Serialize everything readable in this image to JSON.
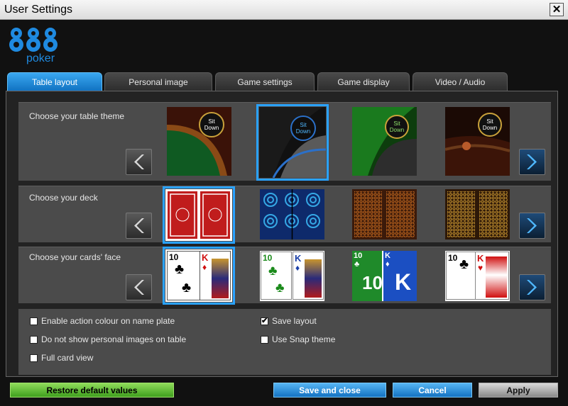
{
  "window": {
    "title": "User Settings",
    "close_symbol": "✕"
  },
  "logo": {
    "numerals": "888",
    "word": "poker"
  },
  "tabs": [
    {
      "label": "Table layout",
      "active": true
    },
    {
      "label": "Personal image",
      "active": false
    },
    {
      "label": "Game settings",
      "active": false
    },
    {
      "label": "Game display",
      "active": false
    },
    {
      "label": "Video / Audio",
      "active": false
    }
  ],
  "theme": {
    "label": "Choose your table theme",
    "seat_button": "Sit Down",
    "seat_line1": "Sit",
    "seat_line2": "Down",
    "selected_index": 1,
    "options": [
      {
        "felt": "#0f5a22",
        "rail": "#8a4a16",
        "bg": "#3a1208"
      },
      {
        "felt": "#1c1c1c",
        "rail": "#2b70c9",
        "bg": "#777777"
      },
      {
        "felt": "#1a7a1e",
        "rail": "#0d3d0d",
        "bg": "#2d2d2d"
      },
      {
        "felt": "#3b1408",
        "rail": "#6b3a1a",
        "bg": "#1b0a05"
      }
    ]
  },
  "deck": {
    "label": "Choose your deck",
    "selected_index": 0,
    "options": [
      {
        "back": "#c01c1c",
        "pattern": "#ffffff"
      },
      {
        "back": "#0e2a6b",
        "pattern": "#35a8e6"
      },
      {
        "back": "#3b1a0a",
        "pattern": "#e27a23"
      },
      {
        "back": "#2d1808",
        "pattern": "#f0b53a"
      }
    ]
  },
  "faces": {
    "label": "Choose your cards' face",
    "selected_index": 0,
    "options": [
      {
        "left_rank": "10",
        "left_suit": "♣",
        "right_rank": "K",
        "right_suit": "♦",
        "style": "classic"
      },
      {
        "left_rank": "10",
        "left_suit": "♣",
        "right_rank": "K",
        "right_suit": "♦",
        "style": "color"
      },
      {
        "left_rank": "10",
        "left_suit": "♣",
        "right_rank": "K",
        "right_suit": "♦",
        "style": "four-color"
      },
      {
        "left_rank": "10",
        "left_suit": "♣",
        "right_rank": "K",
        "right_suit": "♥",
        "style": "large"
      }
    ]
  },
  "options": {
    "enable_action_colour": {
      "label": "Enable action colour on name plate",
      "checked": false
    },
    "no_personal_images": {
      "label": "Do not show personal images on table",
      "checked": false
    },
    "full_card_view": {
      "label": "Full card view",
      "checked": false
    },
    "save_layout": {
      "label": "Save layout",
      "checked": true
    },
    "use_snap_theme": {
      "label": "Use Snap theme",
      "checked": false
    }
  },
  "buttons": {
    "restore": "Restore default values",
    "save_close": "Save and close",
    "cancel": "Cancel",
    "apply": "Apply"
  },
  "icons": {
    "left_arrow": "chevron-left-icon",
    "right_arrow": "chevron-right-icon",
    "check": "✔"
  },
  "colors": {
    "accent_blue": "#1a86d6",
    "restore_green": "#5ec232",
    "panel": "#4b4b4b",
    "logo_blue": "#1f8ae0"
  }
}
